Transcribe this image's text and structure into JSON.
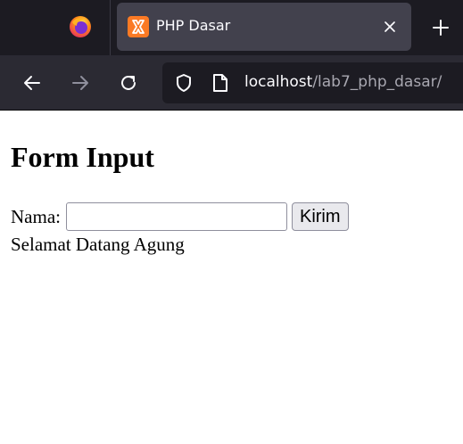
{
  "browser": {
    "tab": {
      "title": "PHP Dasar",
      "favicon": "xampp-icon"
    },
    "url": {
      "host": "localhost",
      "path": "/lab7_php_dasar/"
    },
    "icons": {
      "firefox": "firefox-icon",
      "close": "close-icon",
      "new_tab": "plus-icon",
      "back": "back-arrow-icon",
      "forward": "forward-arrow-icon",
      "reload": "reload-icon",
      "shield": "shield-icon",
      "page": "page-icon"
    },
    "colors": {
      "tabbar_bg": "#1c1b22",
      "active_tab_bg": "#42414d",
      "navbar_bg": "#2b2a33",
      "urlbar_bg": "#1c1b22",
      "xampp_orange": "#fb7a24"
    }
  },
  "page": {
    "title": "Form Input",
    "form": {
      "label": "Nama:",
      "input_value": "",
      "submit_label": "Kirim"
    },
    "greeting": "Selamat Datang Agung"
  }
}
